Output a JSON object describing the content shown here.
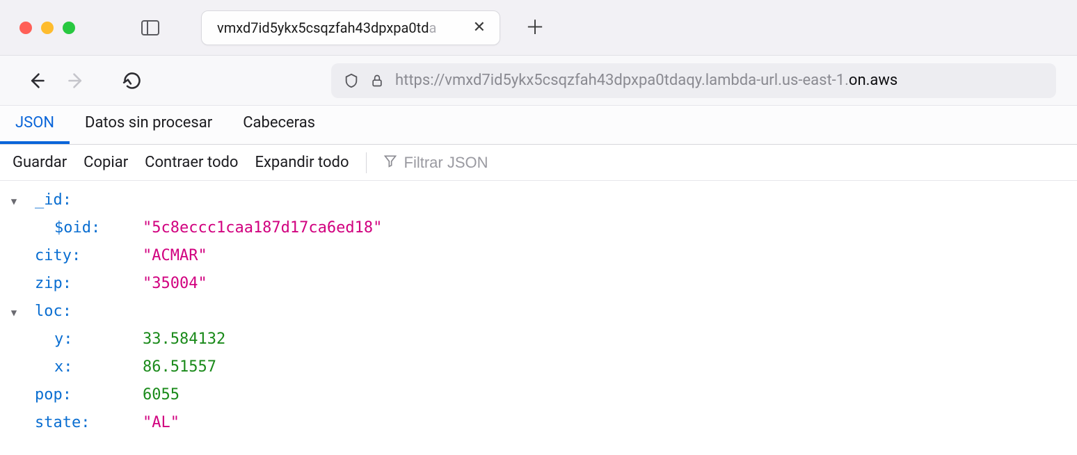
{
  "tab": {
    "title_visible": "vmxd7id5ykx5csqzfah43dpxpa0td",
    "title_faded": "a"
  },
  "address": {
    "prefix": "https://vmxd7id5ykx5csqzfah43dpxpa0tdaqy.lambda-url.us-east-1.",
    "highlight": "on.aws"
  },
  "viewtabs": {
    "json": "JSON",
    "raw": "Datos sin procesar",
    "headers": "Cabeceras"
  },
  "toolbar": {
    "save": "Guardar",
    "copy": "Copiar",
    "collapse": "Contraer todo",
    "expand": "Expandir todo",
    "filter_placeholder": "Filtrar JSON"
  },
  "json": {
    "keys": {
      "_id": "_id:",
      "oid": "$oid:",
      "city": "city:",
      "zip": "zip:",
      "loc": "loc:",
      "y": "y:",
      "x": "x:",
      "pop": "pop:",
      "state": "state:"
    },
    "values": {
      "oid": "\"5c8eccc1caa187d17ca6ed18\"",
      "city": "\"ACMAR\"",
      "zip": "\"35004\"",
      "y": "33.584132",
      "x": "86.51557",
      "pop": "6055",
      "state": "\"AL\""
    }
  }
}
